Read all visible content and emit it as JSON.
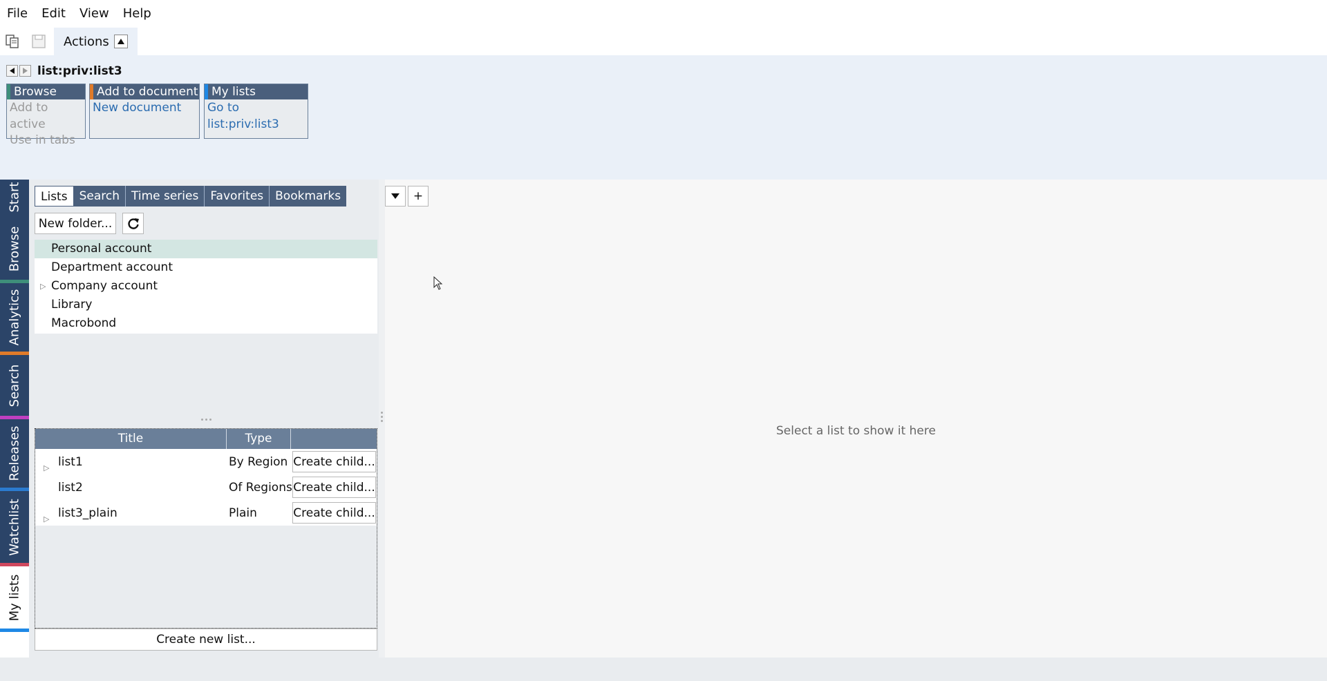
{
  "menubar": {
    "items": [
      "File",
      "Edit",
      "View",
      "Help"
    ]
  },
  "toolbar": {
    "icons": [
      "copy-document-icon",
      "save-icon"
    ],
    "actions_tab_label": "Actions"
  },
  "actions_panel": {
    "current_path": "list:priv:list3",
    "groups": [
      {
        "header": "Browse",
        "accent": "#3e8f7a",
        "links": [
          {
            "label": "Add to active",
            "enabled": false
          },
          {
            "label": "Use in tabs",
            "enabled": false
          }
        ]
      },
      {
        "header": "Add to document",
        "accent": "#e07b2a",
        "links": [
          {
            "label": "New document",
            "enabled": true
          }
        ]
      },
      {
        "header": "My lists",
        "accent": "#1e88e5",
        "links": [
          {
            "label": "Go to list:priv:list3",
            "enabled": true
          }
        ]
      }
    ]
  },
  "vertical_tabs": [
    {
      "label": "Start",
      "accent": "#2b4468"
    },
    {
      "label": "Browse",
      "accent": "#3e8f7a"
    },
    {
      "label": "Analytics",
      "accent": "#e07b2a"
    },
    {
      "label": "Search",
      "accent": "#c03fc0"
    },
    {
      "label": "Releases",
      "accent": "#2b7bd0"
    },
    {
      "label": "Watchlist",
      "accent": "#d0485e"
    },
    {
      "label": "My lists",
      "accent": "#1e88e5"
    }
  ],
  "lists_panel": {
    "subtabs": [
      "Lists",
      "Search",
      "Time series",
      "Favorites",
      "Bookmarks"
    ],
    "new_folder_label": "New folder...",
    "folders": [
      {
        "label": "Personal account",
        "expandable": false
      },
      {
        "label": "Department account",
        "expandable": false
      },
      {
        "label": "Company account",
        "expandable": true
      },
      {
        "label": "Library",
        "expandable": false
      },
      {
        "label": "Macrobond",
        "expandable": false
      }
    ],
    "table": {
      "headers": [
        "Title",
        "Type",
        ""
      ],
      "rows": [
        {
          "title": "list1",
          "type": "By Region",
          "action": "Create child...",
          "expandable": true
        },
        {
          "title": "list2",
          "type": "Of Regions",
          "action": "Create child...",
          "expandable": false
        },
        {
          "title": "list3_plain",
          "type": "Plain",
          "action": "Create child...",
          "expandable": true
        }
      ]
    },
    "create_new_list_label": "Create new list..."
  },
  "right_panel": {
    "add_label": "+",
    "empty_message": "Select a list to show it here"
  }
}
